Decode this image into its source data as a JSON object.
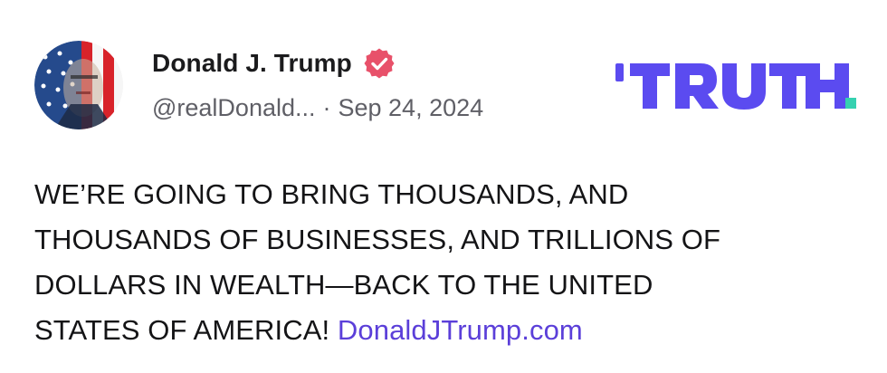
{
  "author": {
    "display_name": "Donald J. Trump",
    "handle": "@realDonald...",
    "separator": "·",
    "date": "Sep 24, 2024"
  },
  "brand": {
    "wordmark": "TRUTH",
    "wordmark_color": "#5b4bf0",
    "dot_color": "#35d1b0"
  },
  "post": {
    "lines": [
      "WE’RE GOING TO BRING THOUSANDS, AND",
      "THOUSANDS OF BUSINESSES, AND TRILLIONS OF",
      "DOLLARS IN WEALTH—BACK TO THE UNITED",
      "STATES OF AMERICA!"
    ],
    "link_text": "DonaldJTrump.com",
    "link_color": "#5b3fd9"
  },
  "icons": {
    "verified": "verified-badge-icon",
    "avatar": "profile-avatar"
  },
  "colors": {
    "verified_badge": "#e8516a",
    "text": "#141416",
    "meta": "#5f5f66"
  }
}
